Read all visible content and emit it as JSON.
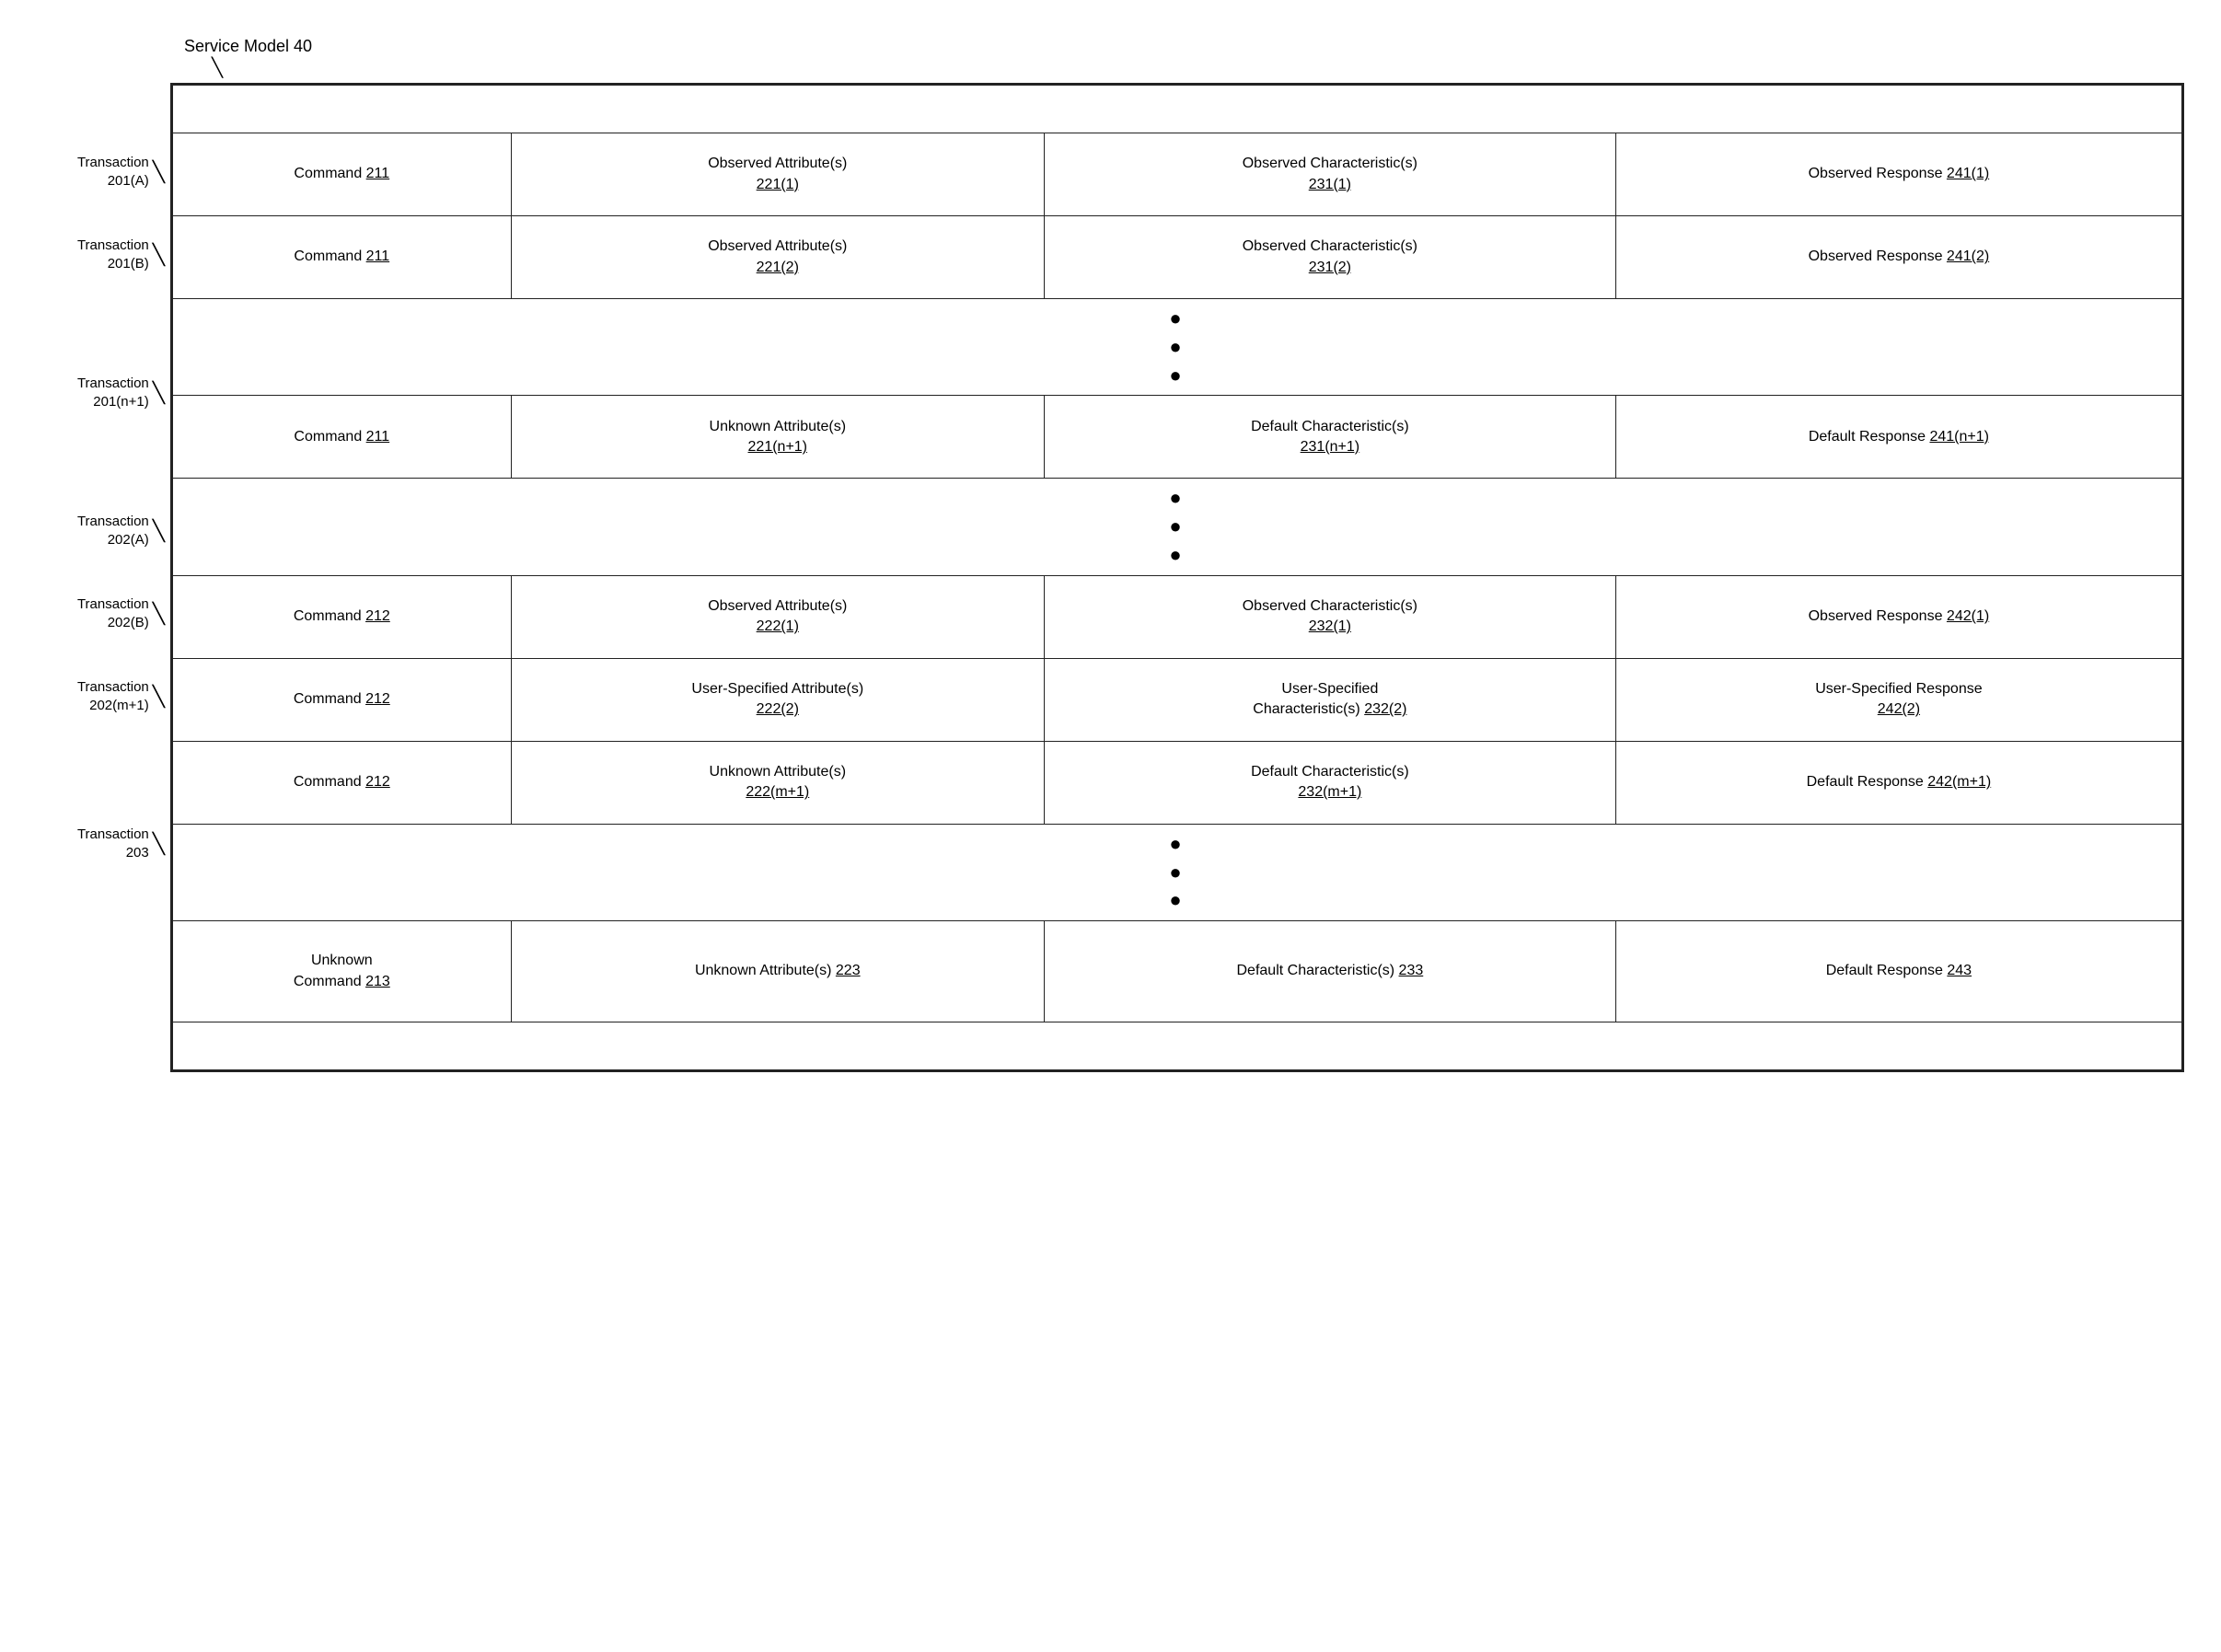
{
  "serviceModel": {
    "label": "Service Model 40",
    "arrow": "╲"
  },
  "leftLabels": [
    {
      "id": "empty-top",
      "text": "",
      "height": 52,
      "hasArrow": false
    },
    {
      "id": "trans-201a",
      "text": "Transaction\n201(A)",
      "height": 90,
      "hasArrow": true
    },
    {
      "id": "trans-201b",
      "text": "Transaction\n201(B)",
      "height": 90,
      "hasArrow": true
    },
    {
      "id": "dots1",
      "text": "",
      "height": 60,
      "hasArrow": false
    },
    {
      "id": "trans-201n1",
      "text": "Transaction\n201(n+1)",
      "height": 90,
      "hasArrow": true
    },
    {
      "id": "dots2",
      "text": "",
      "height": 60,
      "hasArrow": false
    },
    {
      "id": "trans-202a",
      "text": "Transaction\n202(A)",
      "height": 90,
      "hasArrow": true
    },
    {
      "id": "trans-202b",
      "text": "Transaction\n202(B)",
      "height": 90,
      "hasArrow": true
    },
    {
      "id": "trans-202m1",
      "text": "Transaction\n202(m+1)",
      "height": 90,
      "hasArrow": true
    },
    {
      "id": "dots3",
      "text": "",
      "height": 60,
      "hasArrow": false
    },
    {
      "id": "trans-203",
      "text": "Transaction\n203",
      "height": 110,
      "hasArrow": true
    },
    {
      "id": "empty-bottom",
      "text": "",
      "height": 52,
      "hasArrow": false
    }
  ],
  "tableRows": [
    {
      "type": "empty",
      "height": 52
    },
    {
      "type": "data",
      "height": 90,
      "cells": [
        {
          "text": "Command 211",
          "underlinePart": "211"
        },
        {
          "text": "Observed Attribute(s)\n221(1)",
          "underlinePart": "221(1)"
        },
        {
          "text": "Observed Characteristic(s)\n231(1)",
          "underlinePart": "231(1)"
        },
        {
          "text": "Observed Response 241(1)",
          "underlinePart": "241(1)"
        }
      ]
    },
    {
      "type": "data",
      "height": 90,
      "cells": [
        {
          "text": "Command 211",
          "underlinePart": "211"
        },
        {
          "text": "Observed Attribute(s)\n221(2)",
          "underlinePart": "221(2)"
        },
        {
          "text": "Observed Characteristic(s)\n231(2)",
          "underlinePart": "231(2)"
        },
        {
          "text": "Observed Response 241(2)",
          "underlinePart": "241(2)"
        }
      ]
    },
    {
      "type": "dots",
      "height": 60
    },
    {
      "type": "data",
      "height": 90,
      "cells": [
        {
          "text": "Command 211",
          "underlinePart": "211"
        },
        {
          "text": "Unknown Attribute(s)\n221(n+1)",
          "underlinePart": "221(n+1)"
        },
        {
          "text": "Default Characteristic(s)\n231(n+1)",
          "underlinePart": "231(n+1)"
        },
        {
          "text": "Default Response 241(n+1)",
          "underlinePart": "241(n+1)"
        }
      ]
    },
    {
      "type": "dots",
      "height": 60
    },
    {
      "type": "data",
      "height": 90,
      "cells": [
        {
          "text": "Command 212",
          "underlinePart": "212"
        },
        {
          "text": "Observed Attribute(s)\n222(1)",
          "underlinePart": "222(1)"
        },
        {
          "text": "Observed Characteristic(s)\n232(1)",
          "underlinePart": "232(1)"
        },
        {
          "text": "Observed Response 242(1)",
          "underlinePart": "242(1)"
        }
      ]
    },
    {
      "type": "data",
      "height": 90,
      "cells": [
        {
          "text": "Command 212",
          "underlinePart": "212"
        },
        {
          "text": "User-Specified Attribute(s)\n222(2)",
          "underlinePart": "222(2)"
        },
        {
          "text": "User-Specified\nCharacteristic(s) 232(2)",
          "underlinePart": "232(2)"
        },
        {
          "text": "User-Specified Response\n242(2)",
          "underlinePart": "242(2)"
        }
      ]
    },
    {
      "type": "data",
      "height": 90,
      "cells": [
        {
          "text": "Command 212",
          "underlinePart": "212"
        },
        {
          "text": "Unknown Attribute(s)\n222(m+1)",
          "underlinePart": "222(m+1)"
        },
        {
          "text": "Default Characteristic(s)\n232(m+1)",
          "underlinePart": "232(m+1)"
        },
        {
          "text": "Default Response 242(m+1)",
          "underlinePart": "242(m+1)"
        }
      ]
    },
    {
      "type": "dots",
      "height": 60
    },
    {
      "type": "data",
      "height": 110,
      "cells": [
        {
          "text": "Unknown\nCommand 213",
          "underlinePart": "213"
        },
        {
          "text": "Unknown Attribute(s) 223",
          "underlinePart": "223"
        },
        {
          "text": "Default Characteristic(s) 233",
          "underlinePart": "233"
        },
        {
          "text": "Default Response 243",
          "underlinePart": "243"
        }
      ]
    },
    {
      "type": "empty",
      "height": 52
    }
  ],
  "ui": {
    "dots": "●\n●\n●"
  }
}
